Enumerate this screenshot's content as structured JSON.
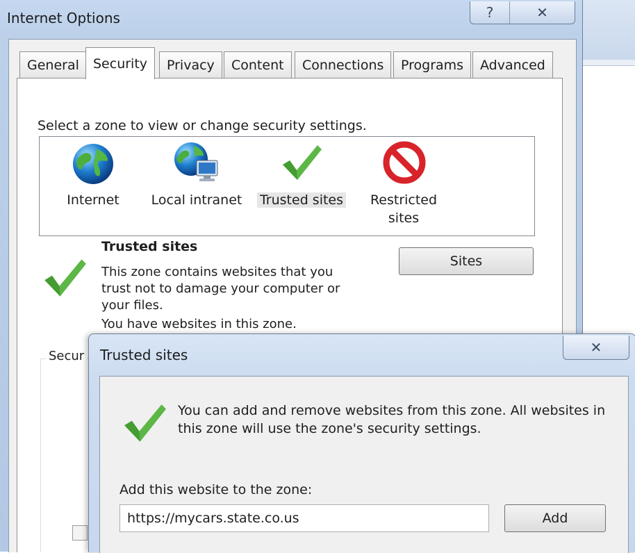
{
  "window": {
    "title": "Internet Options",
    "help_glyph": "?",
    "close_glyph": "✕"
  },
  "tabs": [
    {
      "label": "General",
      "active": false
    },
    {
      "label": "Security",
      "active": true
    },
    {
      "label": "Privacy",
      "active": false
    },
    {
      "label": "Content",
      "active": false
    },
    {
      "label": "Connections",
      "active": false
    },
    {
      "label": "Programs",
      "active": false
    },
    {
      "label": "Advanced",
      "active": false
    }
  ],
  "security": {
    "zone_prompt": "Select a zone to view or change security settings.",
    "zones": [
      {
        "label": "Internet",
        "icon": "globe-icon"
      },
      {
        "label": "Local intranet",
        "icon": "globe-network-icon"
      },
      {
        "label": "Trusted sites",
        "icon": "checkmark-icon",
        "selected": true
      },
      {
        "label_line1": "Restricted",
        "label_line2": "sites",
        "icon": "restricted-icon"
      }
    ],
    "info_title": "Trusted sites",
    "info_text": "This zone contains websites that you trust not to damage your computer or your files.",
    "info_extra": "You have websites in this zone.",
    "sites_button": "Sites",
    "group_label_partial": "Secur"
  },
  "trusted_dialog": {
    "title": "Trusted sites",
    "close_glyph": "✕",
    "message": "You can add and remove websites from this zone. All websites in this zone will use the zone's security settings.",
    "add_label": "Add this website to the zone:",
    "url_value": "https://mycars.state.co.us",
    "add_button": "Add"
  },
  "colors": {
    "check_green": "#4caf3a",
    "restricted_red": "#d8232a",
    "chrome_blue": "#bcd0ea"
  }
}
